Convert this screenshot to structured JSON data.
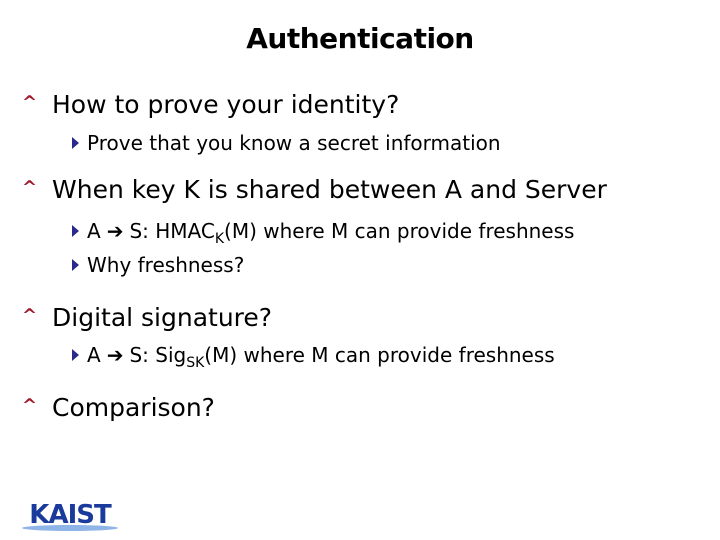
{
  "slide": {
    "title": "Authentication",
    "bullets": [
      {
        "text": "How to prove your identity?",
        "sub": [
          {
            "text": "Prove that you know a secret information"
          }
        ]
      },
      {
        "text": "When key K is shared between A and Server",
        "sub": [
          {
            "from": "A",
            "arrow": "➔",
            "pre": "S: HMAC",
            "subscript": "K",
            "post": "(M) where M can provide freshness"
          },
          {
            "text": "Why freshness?"
          }
        ]
      },
      {
        "text": "Digital signature?",
        "sub": [
          {
            "from": "A",
            "arrow": "➔",
            "pre": "S: Sig",
            "subscript": "SK",
            "post": "(M) where M can provide freshness"
          }
        ]
      },
      {
        "text": "Comparison?"
      }
    ],
    "bullet_glyph": "^",
    "logo_text": "KAIST"
  },
  "colors": {
    "bullet": "#a01828",
    "sub_bullet": "#2a2a8c",
    "logo": "#1a3a9c",
    "logo_swoosh": "#8fb4e8"
  }
}
